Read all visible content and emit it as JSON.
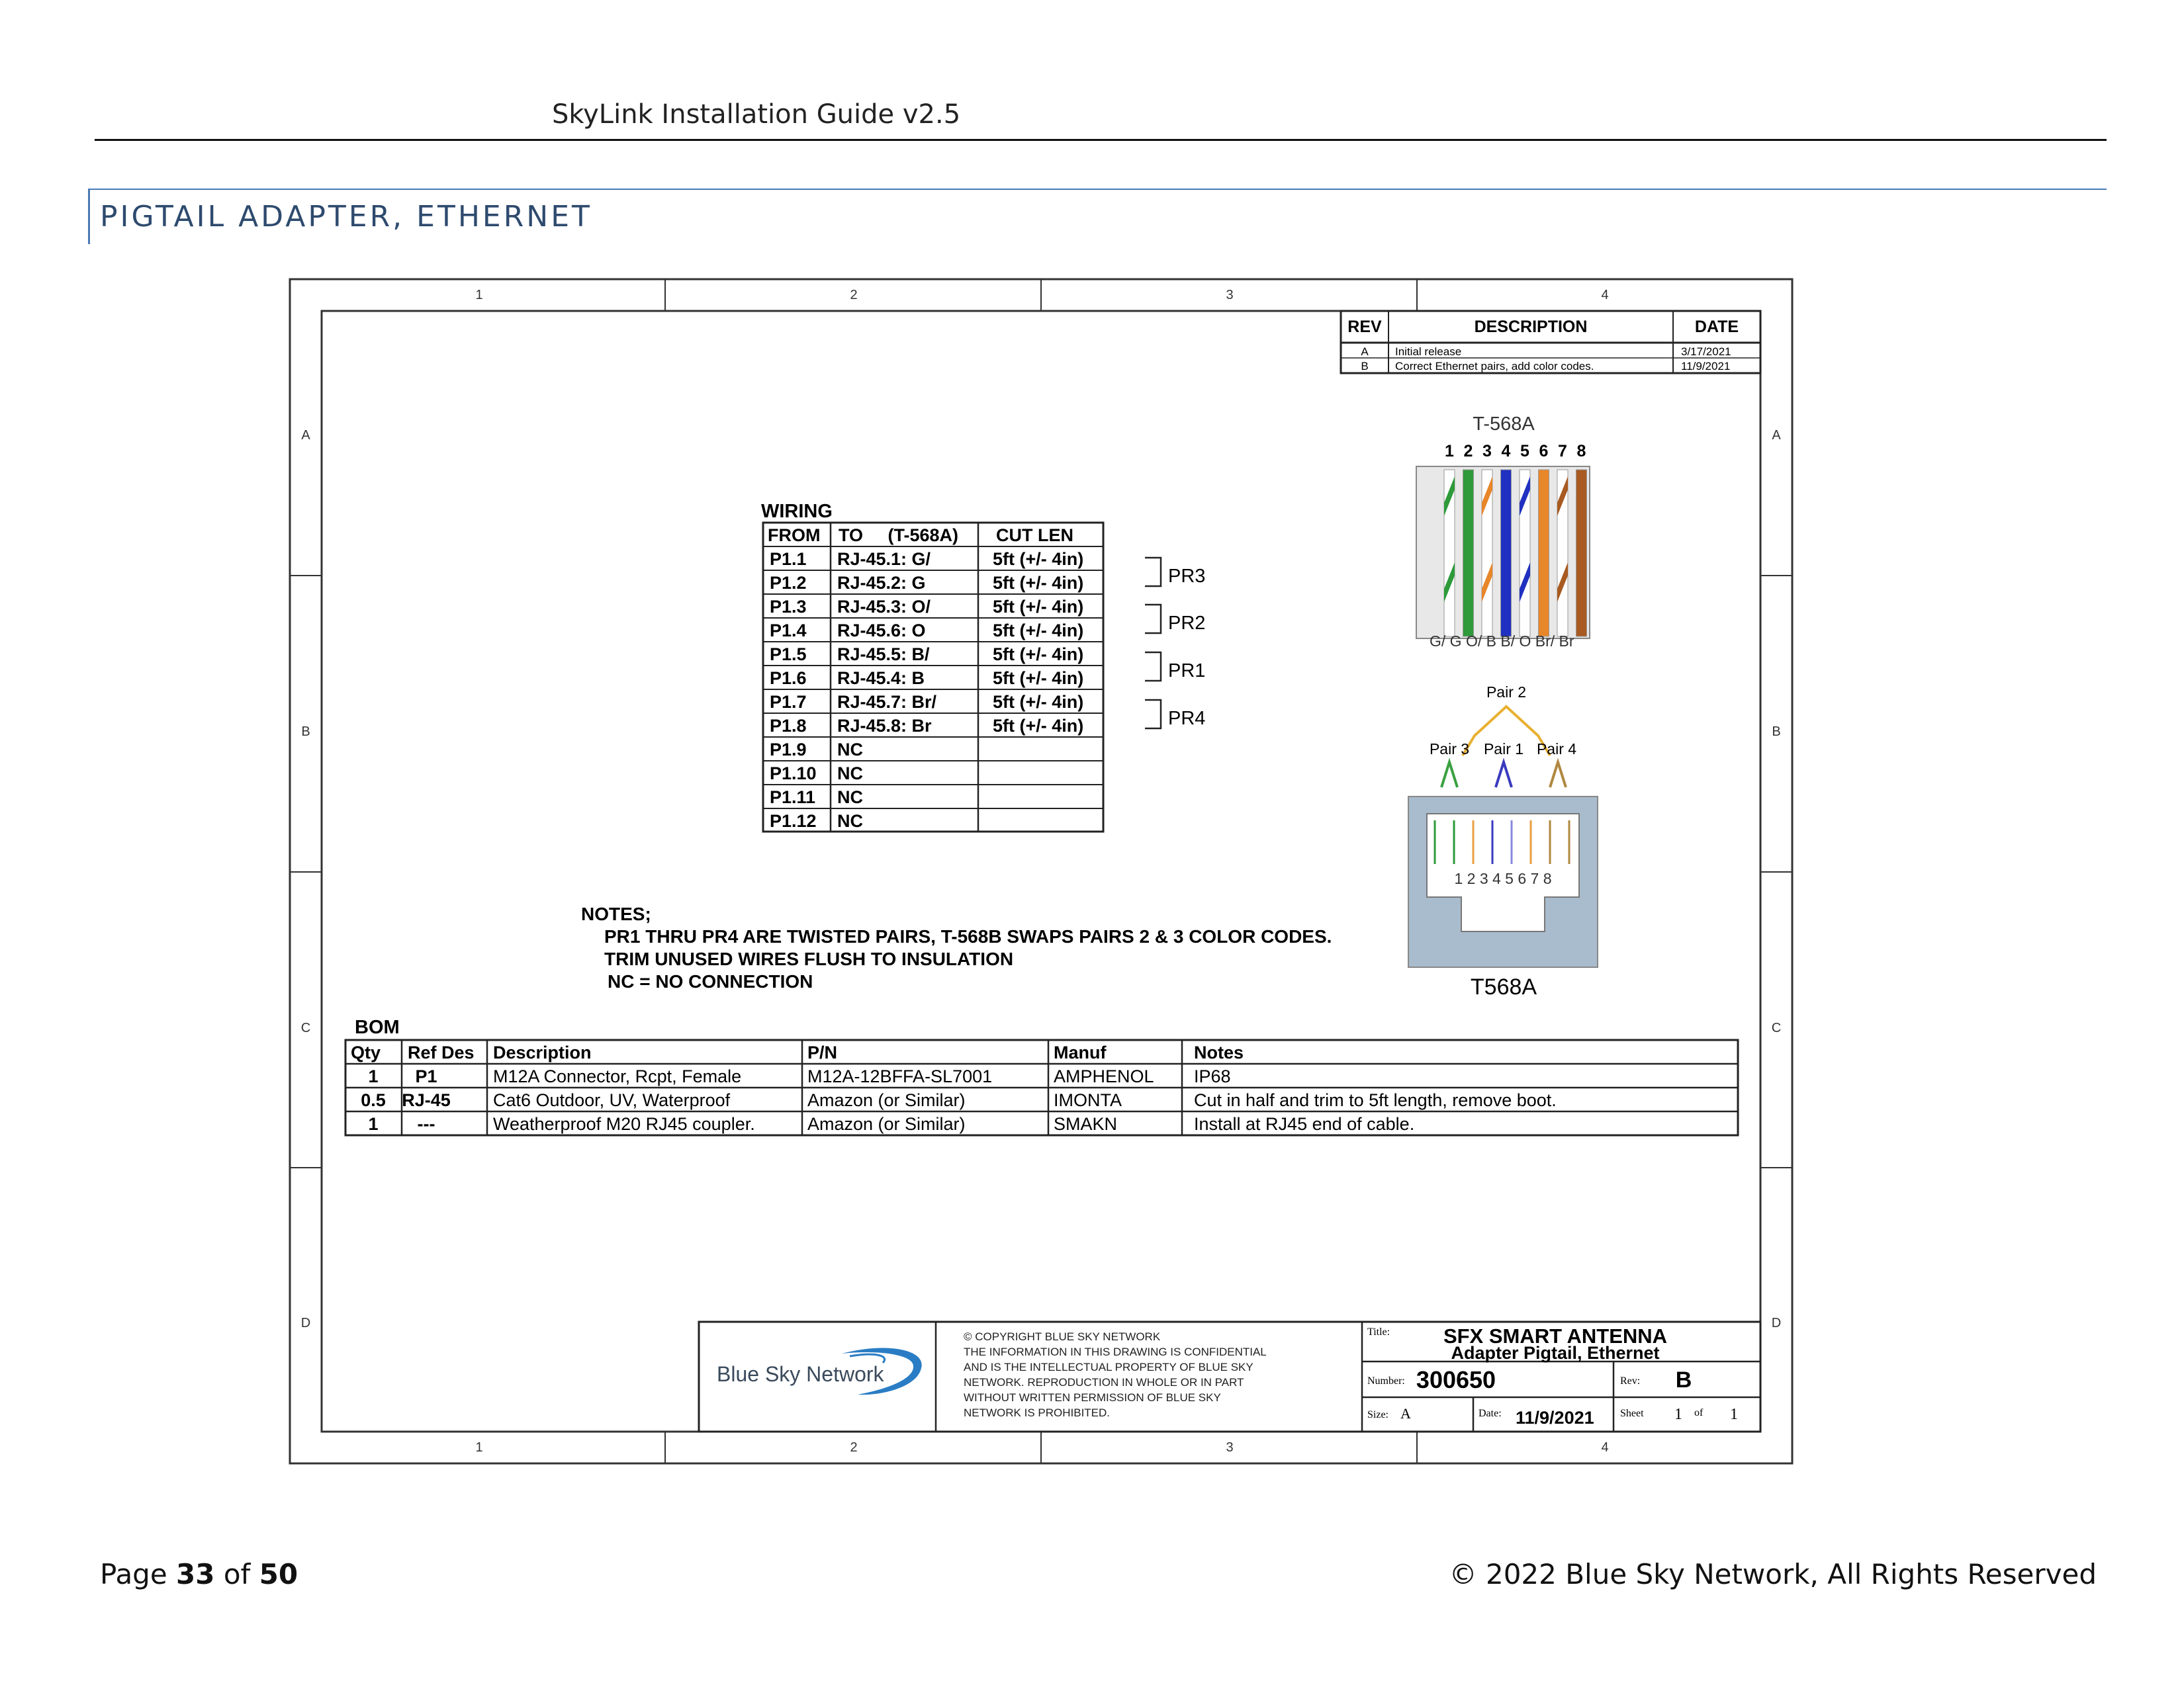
{
  "header": {
    "doc_title": "SkyLink Installation Guide v2.5"
  },
  "section": {
    "title": "PIGTAIL ADAPTER, ETHERNET"
  },
  "drawing": {
    "zones_cols": [
      "1",
      "2",
      "3",
      "4"
    ],
    "zones_rows": [
      "A",
      "B",
      "C",
      "D"
    ],
    "revisions": {
      "headers": [
        "REV",
        "DESCRIPTION",
        "DATE"
      ],
      "rows": [
        [
          "A",
          "Initial release",
          "3/17/2021"
        ],
        [
          "B",
          "Correct Ethernet pairs, add color codes.",
          "11/9/2021"
        ]
      ]
    },
    "wiring": {
      "title": "WIRING",
      "headers": [
        "FROM",
        "TO     (T-568A)",
        "CUT LEN"
      ],
      "rows": [
        [
          "P1.1",
          "RJ-45.1: G/",
          "5ft (+/- 4in)"
        ],
        [
          "P1.2",
          "RJ-45.2: G",
          "5ft (+/- 4in)"
        ],
        [
          "P1.3",
          "RJ-45.3: O/",
          "5ft (+/- 4in)"
        ],
        [
          "P1.4",
          "RJ-45.6: O",
          "5ft (+/- 4in)"
        ],
        [
          "P1.5",
          "RJ-45.5: B/",
          "5ft (+/- 4in)"
        ],
        [
          "P1.6",
          "RJ-45.4: B",
          "5ft (+/- 4in)"
        ],
        [
          "P1.7",
          "RJ-45.7: Br/",
          "5ft (+/- 4in)"
        ],
        [
          "P1.8",
          "RJ-45.8: Br",
          "5ft (+/- 4in)"
        ],
        [
          "P1.9",
          "NC",
          ""
        ],
        [
          "P1.10",
          "NC",
          ""
        ],
        [
          "P1.11",
          "NC",
          ""
        ],
        [
          "P1.12",
          "NC",
          ""
        ]
      ],
      "pairs": [
        "PR3",
        "PR2",
        "PR1",
        "PR4"
      ]
    },
    "t568a_top": {
      "title": "T-568A",
      "pins": [
        "1",
        "2",
        "3",
        "4",
        "5",
        "6",
        "7",
        "8"
      ],
      "labels": "G/ G O/ B B/ O Br/ Br"
    },
    "t568a_jack": {
      "pair2": "Pair 2",
      "pair3": "Pair 3",
      "pair1": "Pair 1",
      "pair4": "Pair 4",
      "pins": "1 2 3 4 5 6 7 8",
      "caption": "T568A"
    },
    "notes": {
      "title": "NOTES;",
      "lines": [
        "PR1 THRU PR4 ARE TWISTED PAIRS, T-568B SWAPS PAIRS 2 & 3 COLOR CODES.",
        "TRIM UNUSED WIRES FLUSH TO INSULATION",
        "NC = NO CONNECTION"
      ]
    },
    "bom": {
      "title": "BOM",
      "headers": [
        "Qty",
        "Ref Des",
        "Description",
        "P/N",
        "Manuf",
        "Notes"
      ],
      "rows": [
        [
          "1",
          "P1",
          "M12A Connector, Rcpt, Female",
          "M12A-12BFFA-SL7001",
          "AMPHENOL",
          "IP68"
        ],
        [
          "0.5",
          "RJ-45",
          "Cat6 Outdoor, UV, Waterproof",
          "Amazon (or Similar)",
          "IMONTA",
          "Cut in half and trim to 5ft length, remove boot."
        ],
        [
          "1",
          "---",
          "Weatherproof M20 RJ45 coupler.",
          "Amazon (or Similar)",
          "SMAKN",
          "Install at RJ45 end of cable."
        ]
      ]
    },
    "title_block": {
      "logo_text": "Blue Sky Network",
      "copyright_lines": [
        "© COPYRIGHT BLUE SKY NETWORK",
        "THE INFORMATION IN THIS DRAWING IS CONFIDENTIAL",
        "AND IS THE INTELLECTUAL PROPERTY OF BLUE SKY",
        "NETWORK. REPRODUCTION IN WHOLE OR IN PART",
        "WITHOUT WRITTEN PERMISSION OF BLUE SKY",
        "NETWORK IS PROHIBITED."
      ],
      "title_label": "Title:",
      "title_line1": "SFX SMART ANTENNA",
      "title_line2": "Adapter Pigtail, Ethernet",
      "number_label": "Number:",
      "number": "300650",
      "rev_label": "Rev:",
      "rev": "B",
      "size_label": "Size:",
      "size": "A",
      "date_label": "Date:",
      "date": "11/9/2021",
      "sheet_label": "Sheet",
      "sheet": "1",
      "of_label": "of",
      "sheet_total": "1"
    }
  },
  "footer": {
    "page_prefix": "Page ",
    "page_number": "33",
    "page_of": " of ",
    "page_total": "50",
    "copyright": "© 2022 Blue Sky Network, All Rights Reserved"
  }
}
